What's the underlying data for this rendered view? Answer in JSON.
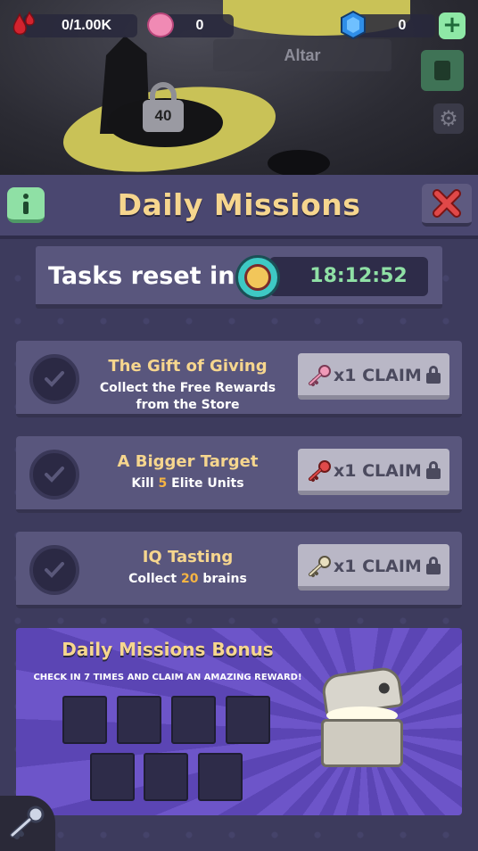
{
  "topbar": {
    "blood": "0/1.00K",
    "brains": "0",
    "gems": "0",
    "plus_label": "+"
  },
  "scene": {
    "location_label": "Altar",
    "lock_level": "40"
  },
  "panel": {
    "title": "Daily Missions",
    "timer_label": "Tasks reset in",
    "timer_value": "18:12:52"
  },
  "missions": [
    {
      "title": "The Gift of Giving",
      "desc_line1": "Collect the Free Rewards",
      "desc_line2": "from the Store",
      "reward": "x1 CLAIM",
      "key_color": "#f09ab8"
    },
    {
      "title": "A Bigger Target",
      "desc_pre": "Kill ",
      "desc_num": "5",
      "desc_post": " Elite Units",
      "reward": "x1 CLAIM",
      "key_color": "#e04a4a"
    },
    {
      "title": "IQ Tasting",
      "desc_pre": "Collect ",
      "desc_num": "20",
      "desc_post": " brains",
      "reward": "x1 CLAIM",
      "key_color": "#c9b98a"
    }
  ],
  "bonus": {
    "title": "Daily Missions Bonus",
    "subtitle": "CHECK IN 7 TIMES AND CLAIM AN AMAZING REWARD!"
  },
  "colors": {
    "accent_gold": "#f6d68e",
    "accent_green": "#8fe0a5",
    "panel_bg": "#3d3b5d",
    "close_red": "#e04848"
  }
}
